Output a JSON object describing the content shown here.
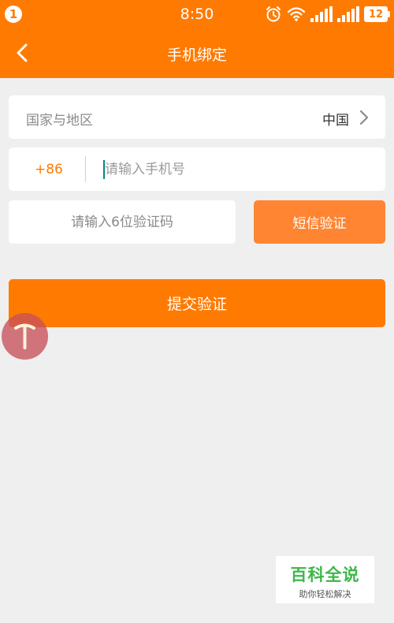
{
  "status_bar": {
    "notification_count": "1",
    "time": "8:50",
    "battery": "12",
    "icons": [
      "alarm-icon",
      "wifi-icon",
      "signal-icon",
      "signal-icon"
    ]
  },
  "header": {
    "title": "手机绑定",
    "back_icon": "chevron-left-icon"
  },
  "form": {
    "country_label": "国家与地区",
    "country_value": "中国",
    "phone_prefix": "+86",
    "phone_placeholder": "请输入手机号",
    "phone_value": "",
    "code_placeholder": "请输入6位验证码",
    "code_value": "",
    "sms_button": "短信验证",
    "submit_button": "提交验证"
  },
  "watermark": {
    "title": "百科全说",
    "subtitle": "助你轻松解决"
  },
  "colors": {
    "accent": "#ff7a00",
    "sms_button": "#ff8533",
    "background": "#efefef",
    "watermark_green": "#3cb848"
  }
}
